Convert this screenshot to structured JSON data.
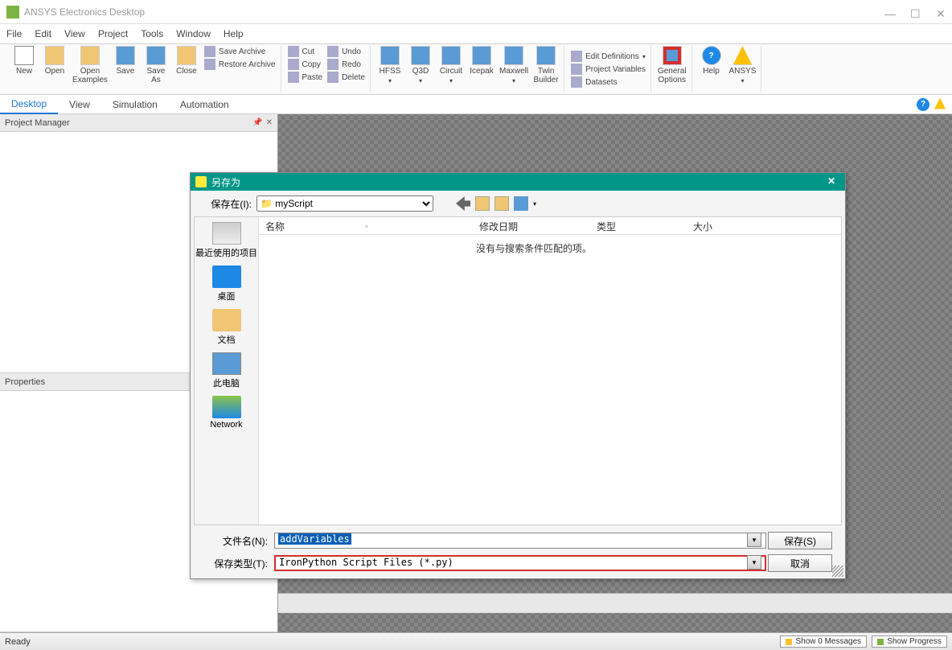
{
  "app": {
    "title": "ANSYS Electronics Desktop"
  },
  "menu": [
    "File",
    "Edit",
    "View",
    "Project",
    "Tools",
    "Window",
    "Help"
  ],
  "ribbon": {
    "new": "New",
    "open": "Open",
    "openex": "Open\nExamples",
    "save": "Save",
    "saveas": "Save\nAs",
    "close": "Close",
    "savearc": "Save Archive",
    "restorearc": "Restore Archive",
    "cut": "Cut",
    "copy": "Copy",
    "paste": "Paste",
    "undo": "Undo",
    "redo": "Redo",
    "delete": "Delete",
    "hfss": "HFSS",
    "q3d": "Q3D",
    "circuit": "Circuit",
    "icepak": "Icepak",
    "maxwell": "Maxwell",
    "twin": "Twin\nBuilder",
    "editdef": "Edit Definitions",
    "projvars": "Project Variables",
    "datasets": "Datasets",
    "genopts": "General\nOptions",
    "help": "Help",
    "ansys": "ANSYS"
  },
  "ribbontabs": {
    "desktop": "Desktop",
    "view": "View",
    "sim": "Simulation",
    "auto": "Automation"
  },
  "panels": {
    "pm": "Project Manager",
    "props": "Properties"
  },
  "status": {
    "ready": "Ready",
    "msgs": "Show 0 Messages",
    "prog": "Show Progress"
  },
  "dialog": {
    "title": "另存为",
    "savein": "保存在(I):",
    "folder": "myScript",
    "sidebar": {
      "recent": "最近使用的项目",
      "desktop": "桌面",
      "docs": "文档",
      "pc": "此电脑",
      "net": "Network"
    },
    "cols": {
      "name": "名称",
      "date": "修改日期",
      "type": "类型",
      "size": "大小"
    },
    "empty": "没有与搜索条件匹配的项。",
    "fname_lbl": "文件名(N):",
    "ftype_lbl": "保存类型(T):",
    "fname": "addVariables",
    "ftype": "IronPython Script Files (*.py)",
    "save": "保存(S)",
    "cancel": "取消"
  }
}
